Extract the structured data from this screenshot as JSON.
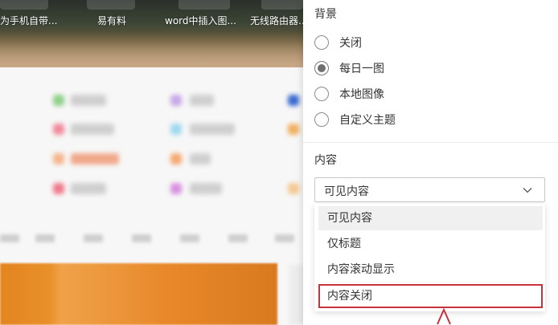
{
  "shortcuts": [
    {
      "label": "为手机自带..."
    },
    {
      "label": "易有料"
    },
    {
      "label": "word中插入图..."
    },
    {
      "label": "无线路由器..."
    }
  ],
  "settings": {
    "background": {
      "title": "背景",
      "options": [
        {
          "label": "关闭",
          "checked": false
        },
        {
          "label": "每日一图",
          "checked": true
        },
        {
          "label": "本地图像",
          "checked": false
        },
        {
          "label": "自定义主题",
          "checked": false
        }
      ]
    },
    "content": {
      "title": "内容",
      "selected": "可见内容",
      "options": [
        {
          "label": "可见内容"
        },
        {
          "label": "仅标题"
        },
        {
          "label": "内容滚动显示"
        },
        {
          "label": "内容关闭"
        }
      ]
    }
  },
  "colors": {
    "highlight_border": "#c8323c",
    "accent_orange": "#e38420"
  },
  "icons": [
    "chevron-down-icon",
    "cursor-arrow-icon"
  ]
}
